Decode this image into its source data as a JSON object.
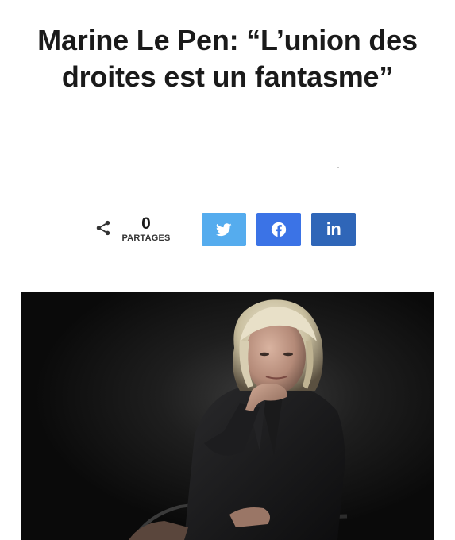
{
  "article": {
    "title": "Marine Le Pen: “L’union des droites est un fantasme”"
  },
  "share": {
    "count": "0",
    "count_label": "PARTAGES",
    "buttons": [
      {
        "network": "twitter",
        "icon": "twitter-icon",
        "color": "#55acee"
      },
      {
        "network": "facebook",
        "icon": "facebook-icon",
        "color": "#3b73e6"
      },
      {
        "network": "linkedin",
        "icon": "linkedin-icon",
        "label": "in",
        "color": "#2f66b8"
      }
    ]
  },
  "photo": {
    "subject": "portrait-photo",
    "background_color": "#0c0c0c"
  }
}
